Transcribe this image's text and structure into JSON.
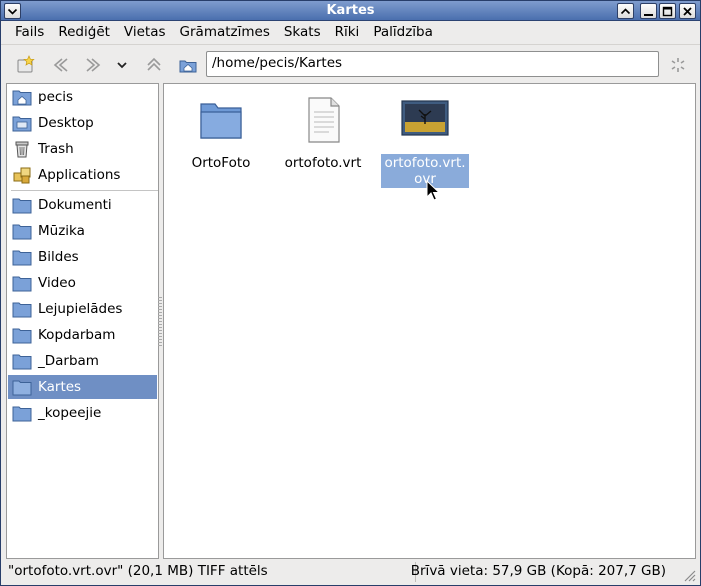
{
  "window": {
    "title": "Kartes"
  },
  "menubar": {
    "items": [
      "Fails",
      "Rediģēt",
      "Vietas",
      "Grāmatzīmes",
      "Skats",
      "Rīki",
      "Palīdzība"
    ]
  },
  "toolbar": {
    "location_value": "/home/pecis/Kartes"
  },
  "sidebar": {
    "places": [
      {
        "label": "pecis",
        "icon": "home-folder-icon"
      },
      {
        "label": "Desktop",
        "icon": "desktop-icon"
      },
      {
        "label": "Trash",
        "icon": "trash-icon"
      },
      {
        "label": "Applications",
        "icon": "applications-icon"
      }
    ],
    "bookmarks": [
      {
        "label": "Dokumenti",
        "icon": "folder-icon"
      },
      {
        "label": "Mūzika",
        "icon": "folder-icon"
      },
      {
        "label": "Bildes",
        "icon": "folder-icon"
      },
      {
        "label": "Video",
        "icon": "folder-icon"
      },
      {
        "label": "Lejupielādes",
        "icon": "folder-icon"
      },
      {
        "label": "Kopdarbam",
        "icon": "folder-icon"
      },
      {
        "label": "_Darbam",
        "icon": "folder-icon"
      },
      {
        "label": "Kartes",
        "icon": "folder-icon",
        "selected": true
      },
      {
        "label": "_kopeejie",
        "icon": "folder-icon"
      }
    ]
  },
  "files": [
    {
      "name": "OrtoFoto",
      "icon": "folder-icon"
    },
    {
      "name": "ortofoto.vrt",
      "icon": "text-document-icon"
    },
    {
      "name": "ortofoto.vrt.ovr",
      "icon": "image-thumbnail-icon",
      "selected": true
    }
  ],
  "statusbar": {
    "selection_info": "\"ortofoto.vrt.ovr\" (20,1 MB) TIFF attēls",
    "free_space": "Brīvā vieta: 57,9 GB (Kopā: 207,7 GB)"
  },
  "colors": {
    "titlebar": "#5a7dbb",
    "selection": "#6f8fc4",
    "folder": "#6f9ad6"
  }
}
